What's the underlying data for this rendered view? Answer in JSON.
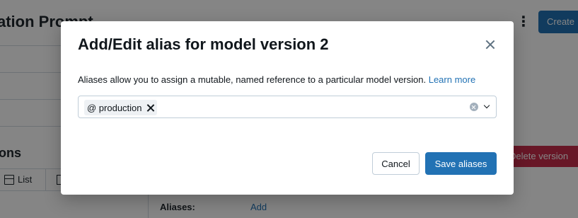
{
  "background": {
    "page_title": "ation Prompt",
    "create_label": "Create",
    "section_title": "ons",
    "list_view_label": "List",
    "delete_label": "Delete version",
    "aliases_label": "Aliases:",
    "aliases_add_link": "Add"
  },
  "modal": {
    "title": "Add/Edit alias for model version 2",
    "description": "Aliases allow you to assign a mutable, named reference to a particular model version.",
    "learn_more": "Learn more",
    "aliases": [
      {
        "label": "@ production"
      }
    ],
    "cancel_label": "Cancel",
    "save_label": "Save aliases"
  },
  "colors": {
    "primary": "#2272b4",
    "danger": "#c82d4c",
    "text": "#11171c",
    "border": "#c0cdd8"
  },
  "icons": [
    "close-icon",
    "tag-remove-icon",
    "clear-icon",
    "chevron-down-icon",
    "list-icon",
    "kebab-menu-icon"
  ]
}
